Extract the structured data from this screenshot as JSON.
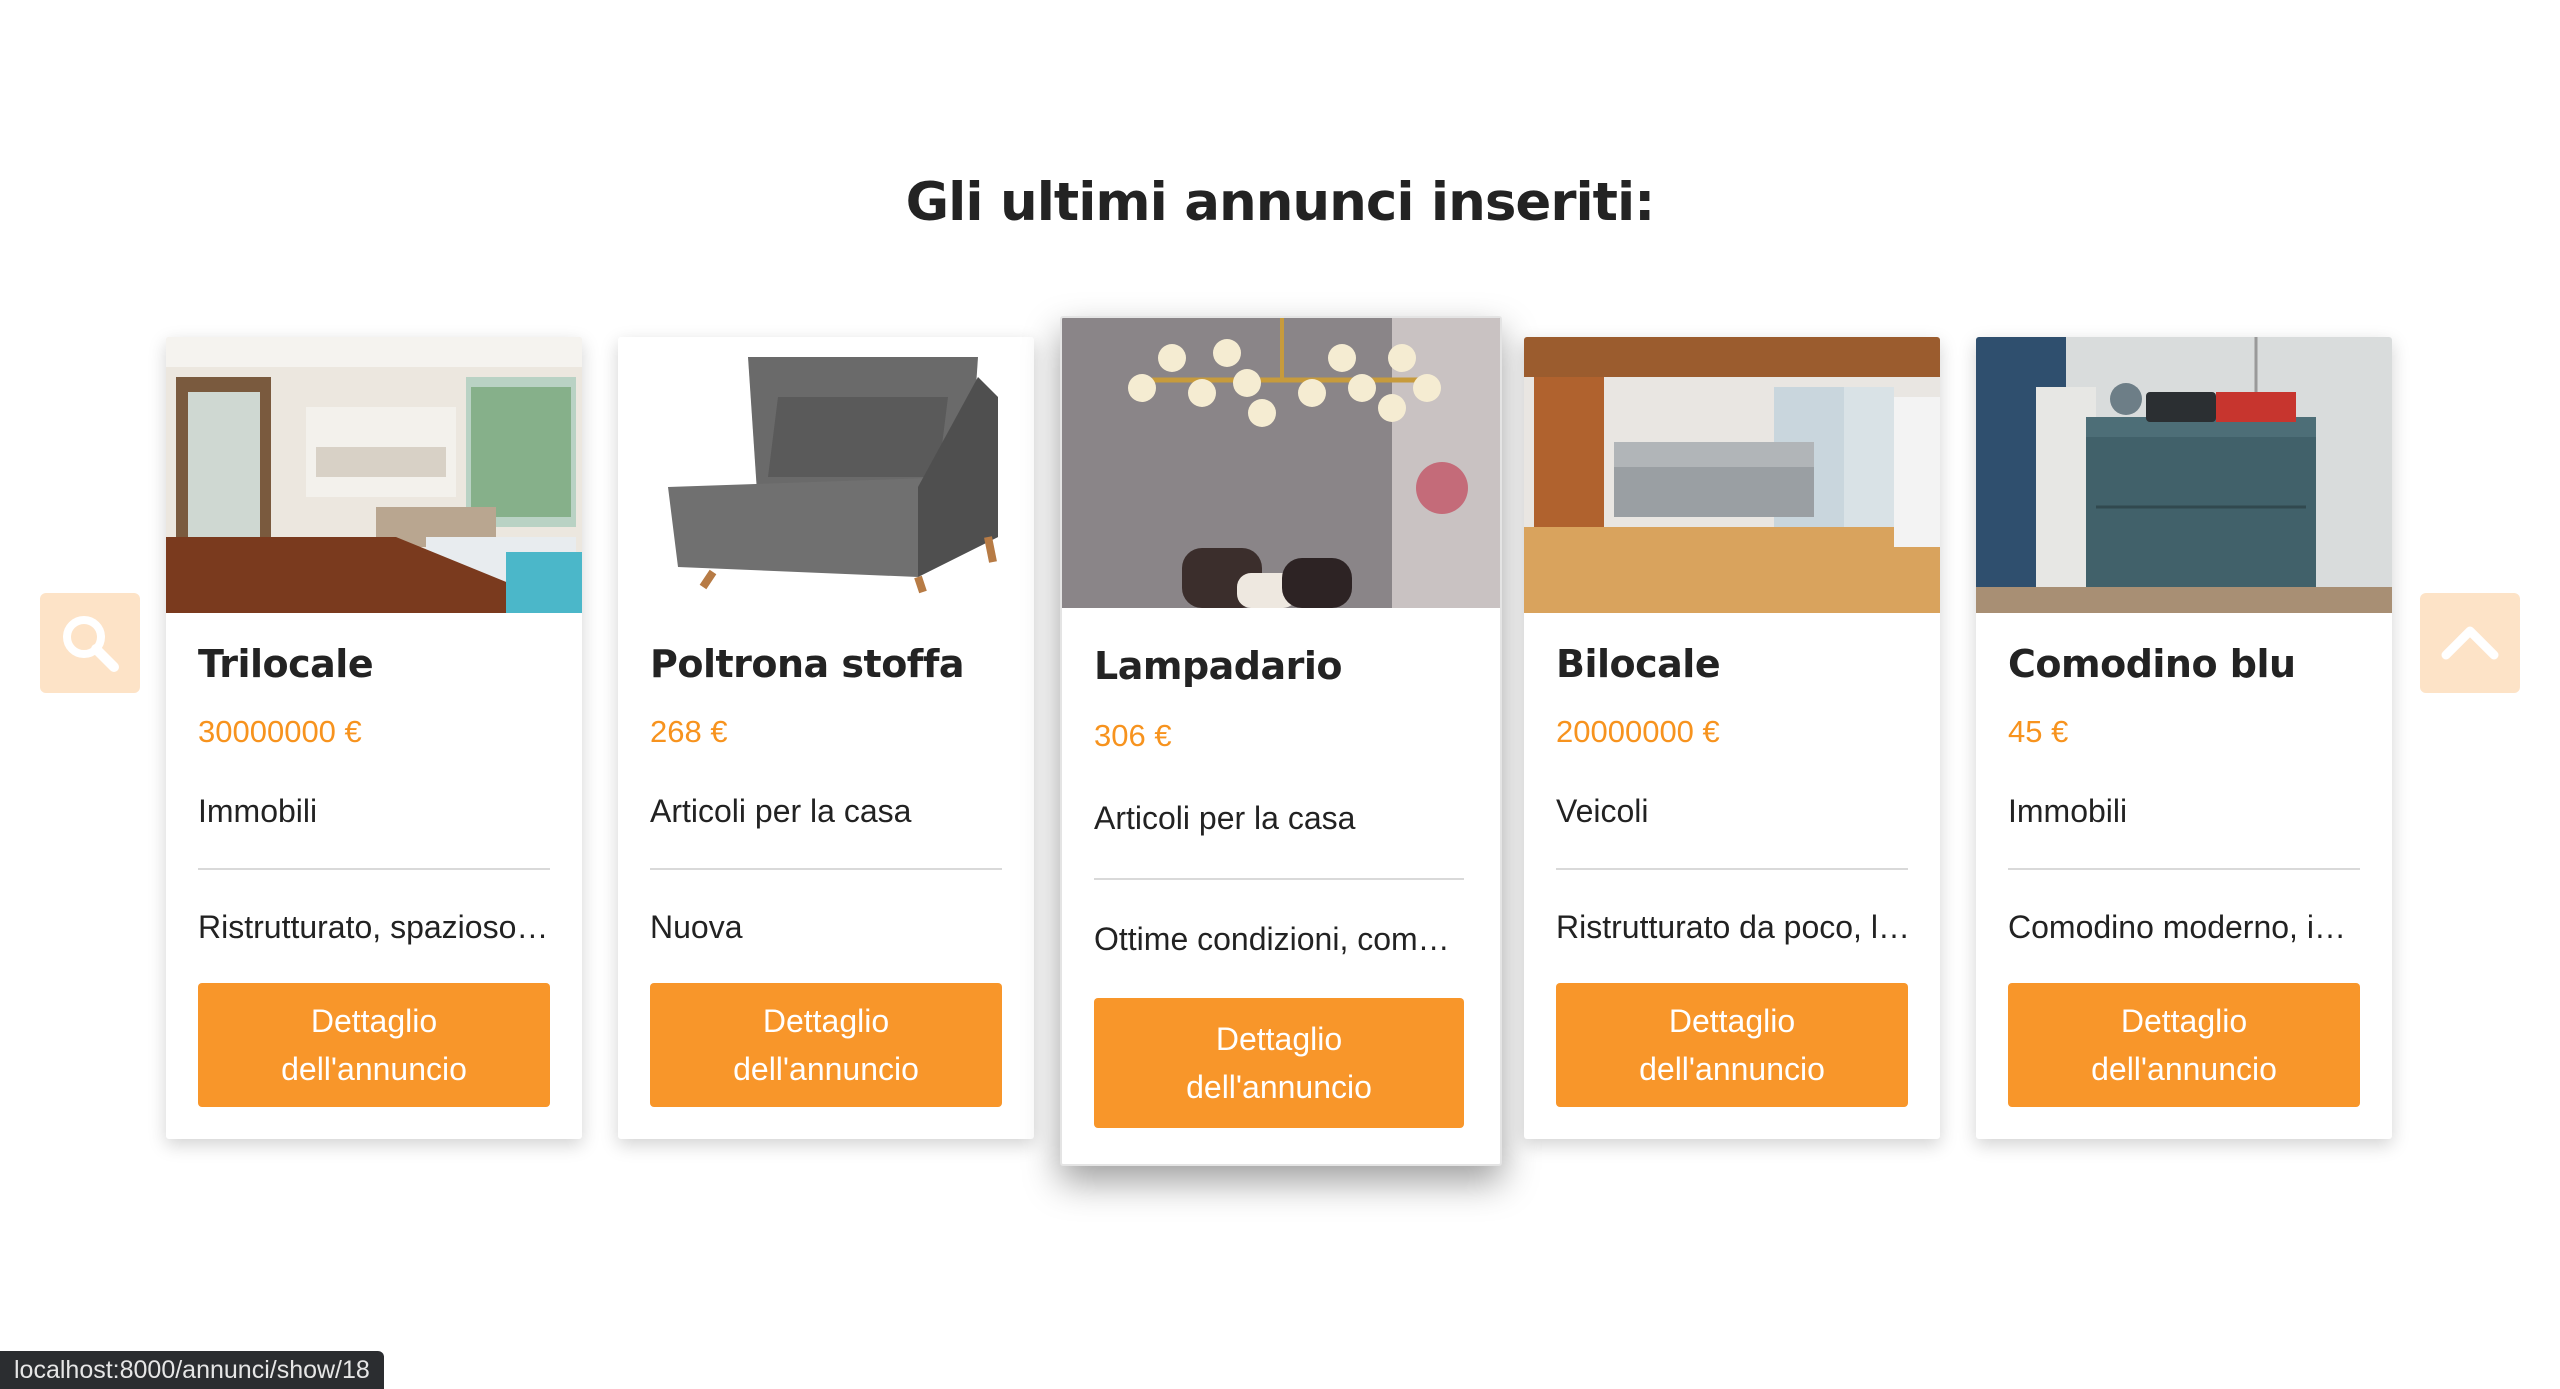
{
  "section": {
    "heading": "Gli ultimi annunci inseriti:"
  },
  "accent_color": "#f8962a",
  "price_color": "#f7931e",
  "carousel": {
    "prev_icon": "search-icon",
    "next_icon": "chevron-up-icon",
    "cards": [
      {
        "title": "Trilocale",
        "price": "30000000 €",
        "category": "Immobili",
        "description": "Ristrutturato, spazioso, luminoso",
        "button": "Dettaglio dell'annuncio",
        "image": "apartment-photo"
      },
      {
        "title": "Poltrona stoffa",
        "price": "268 €",
        "category": "Articoli per la casa",
        "description": "Nuova",
        "button": "Dettaglio dell'annuncio",
        "image": "armchair-photo"
      },
      {
        "title": "Lampadario",
        "price": "306 €",
        "category": "Articoli per la casa",
        "description": "Ottime condizioni, come nuovo",
        "button": "Dettaglio dell'annuncio",
        "image": "chandelier-photo"
      },
      {
        "title": "Bilocale",
        "price": "20000000 €",
        "category": "Veicoli",
        "description": "Ristrutturato da poco, luminoso",
        "button": "Dettaglio dell'annuncio",
        "image": "living-room-photo"
      },
      {
        "title": "Comodino blu",
        "price": "45 €",
        "category": "Immobili",
        "description": "Comodino moderno, in legno",
        "button": "Dettaglio dell'annuncio",
        "image": "nightstand-photo"
      }
    ]
  },
  "status_bar": {
    "url": "localhost:8000/annunci/show/18"
  }
}
